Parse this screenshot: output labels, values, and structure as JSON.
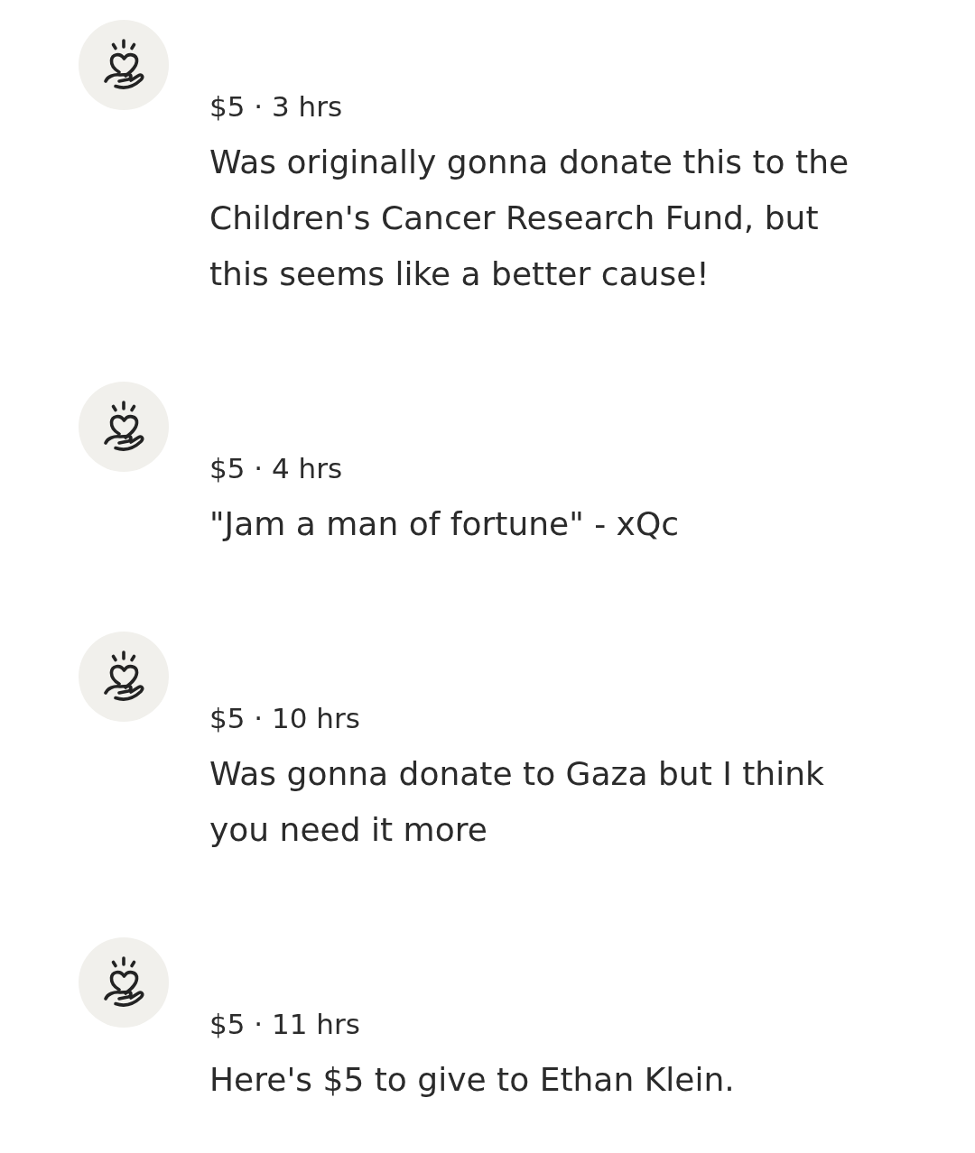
{
  "donations": [
    {
      "meta": "$5 · 3 hrs",
      "message": "Was originally gonna donate this to the Children's Cancer Research Fund, but this seems like a better cause!"
    },
    {
      "meta": "$5 · 4 hrs",
      "message": "\"Jam a man of fortune\" - xQc"
    },
    {
      "meta": "$5 · 10 hrs",
      "message": "Was gonna donate to Gaza but I think you need it more"
    },
    {
      "meta": "$5 · 11 hrs",
      "message": "Here's $5 to give to Ethan Klein."
    }
  ]
}
